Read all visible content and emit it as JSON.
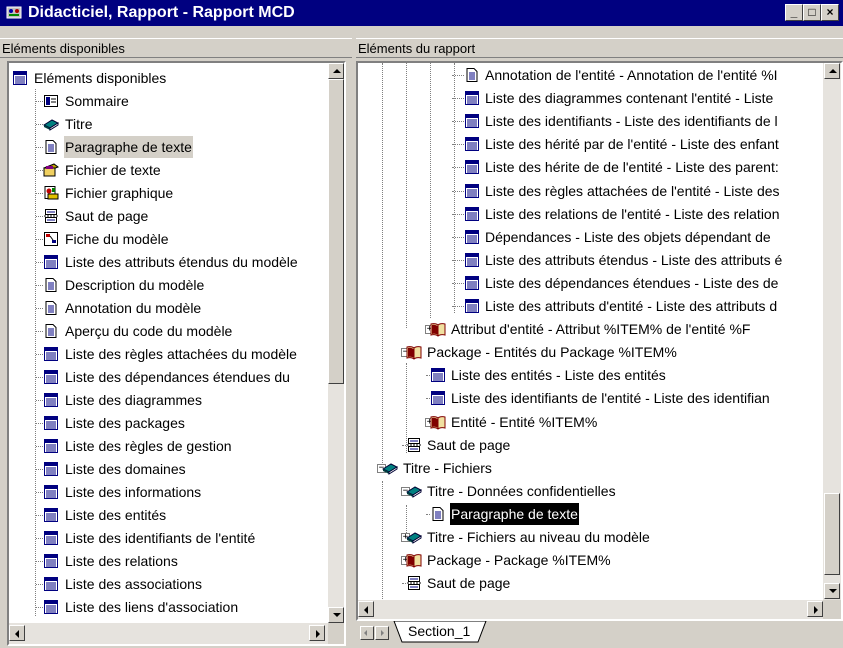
{
  "window": {
    "title": "Didacticiel, Rapport - Rapport MCD",
    "minimize_label": "_",
    "maximize_label": "□",
    "close_label": "×"
  },
  "left_panel": {
    "header": "Eléments disponibles",
    "items": [
      {
        "label": "Eléments disponibles",
        "icon": "list-icon"
      },
      {
        "label": "Sommaire",
        "icon": "summary-icon"
      },
      {
        "label": "Titre",
        "icon": "book-icon"
      },
      {
        "label": "Paragraphe de texte",
        "icon": "document-icon"
      },
      {
        "label": "Fichier de texte",
        "icon": "text-file-icon"
      },
      {
        "label": "Fichier graphique",
        "icon": "graphic-file-icon"
      },
      {
        "label": "Saut de page",
        "icon": "page-break-icon"
      },
      {
        "label": "Fiche du modèle",
        "icon": "model-card-icon"
      },
      {
        "label": "Liste des attributs étendus du modèle",
        "icon": "list-icon"
      },
      {
        "label": "Description du modèle",
        "icon": "document-icon"
      },
      {
        "label": "Annotation du modèle",
        "icon": "document-icon"
      },
      {
        "label": "Aperçu du code du modèle",
        "icon": "document-icon"
      },
      {
        "label": "Liste des règles attachées du modèle",
        "icon": "list-icon"
      },
      {
        "label": "Liste des dépendances étendues du",
        "icon": "list-icon"
      },
      {
        "label": "Liste des diagrammes",
        "icon": "list-icon"
      },
      {
        "label": "Liste des packages",
        "icon": "list-icon"
      },
      {
        "label": "Liste des règles de gestion",
        "icon": "list-icon"
      },
      {
        "label": "Liste des domaines",
        "icon": "list-icon"
      },
      {
        "label": "Liste des informations",
        "icon": "list-icon"
      },
      {
        "label": "Liste des entités",
        "icon": "list-icon"
      },
      {
        "label": "Liste des identifiants de l'entité",
        "icon": "list-icon"
      },
      {
        "label": "Liste des relations",
        "icon": "list-icon"
      },
      {
        "label": "Liste des associations",
        "icon": "list-icon"
      },
      {
        "label": "Liste des liens d'association",
        "icon": "list-icon"
      }
    ],
    "selected_index": 3
  },
  "right_panel": {
    "header": "Eléments du rapport",
    "items": [
      {
        "label": "Annotation de l'entité - Annotation de l'entité %I",
        "icon": "document-icon",
        "level": 3
      },
      {
        "label": "Liste des diagrammes contenant l'entité - Liste",
        "icon": "list-icon",
        "level": 3
      },
      {
        "label": "Liste des identifiants - Liste des identifiants de l",
        "icon": "list-icon",
        "level": 3
      },
      {
        "label": "Liste des hérité par de l'entité - Liste des enfant",
        "icon": "list-icon",
        "level": 3
      },
      {
        "label": "Liste des hérite de de l'entité - Liste des parent:",
        "icon": "list-icon",
        "level": 3
      },
      {
        "label": "Liste des règles attachées de l'entité - Liste des",
        "icon": "list-icon",
        "level": 3
      },
      {
        "label": "Liste des relations de l'entité - Liste des relation",
        "icon": "list-icon",
        "level": 3
      },
      {
        "label": "Dépendances - Liste des objets dépendant de",
        "icon": "list-icon",
        "level": 3
      },
      {
        "label": "Liste des attributs étendus - Liste des attributs é",
        "icon": "list-icon",
        "level": 3
      },
      {
        "label": "Liste des dépendances étendues - Liste des de",
        "icon": "list-icon",
        "level": 3
      },
      {
        "label": "Liste des attributs d'entité - Liste des attributs d",
        "icon": "list-icon",
        "level": 3
      },
      {
        "label": "Attribut d'entité - Attribut %ITEM% de l'entité %F",
        "icon": "package-icon",
        "level": 2,
        "expander": "+"
      },
      {
        "label": "Package - Entités du Package %ITEM%",
        "icon": "package-icon",
        "level": 1,
        "expander": "-"
      },
      {
        "label": "Liste des entités - Liste des entités",
        "icon": "list-icon",
        "level": 2
      },
      {
        "label": "Liste des identifiants de l'entité - Liste des identifian",
        "icon": "list-icon",
        "level": 2
      },
      {
        "label": "Entité - Entité %ITEM%",
        "icon": "package-icon",
        "level": 2,
        "expander": "+"
      },
      {
        "label": "Saut de page",
        "icon": "page-break-icon",
        "level": 1
      },
      {
        "label": "Titre - Fichiers",
        "icon": "book-icon",
        "level": 0,
        "expander": "-"
      },
      {
        "label": "Titre - Données confidentielles",
        "icon": "book-icon",
        "level": 1,
        "expander": "-"
      },
      {
        "label": "Paragraphe de texte",
        "icon": "document-icon",
        "level": 2,
        "selected": true
      },
      {
        "label": "Titre - Fichiers au niveau du modèle",
        "icon": "book-icon",
        "level": 1,
        "expander": "+"
      },
      {
        "label": "Package - Package %ITEM%",
        "icon": "package-icon",
        "level": 1,
        "expander": "+"
      },
      {
        "label": "Saut de page",
        "icon": "page-break-icon",
        "level": 1
      }
    ]
  },
  "tabs": [
    {
      "label": "Section_1",
      "active": true
    }
  ]
}
